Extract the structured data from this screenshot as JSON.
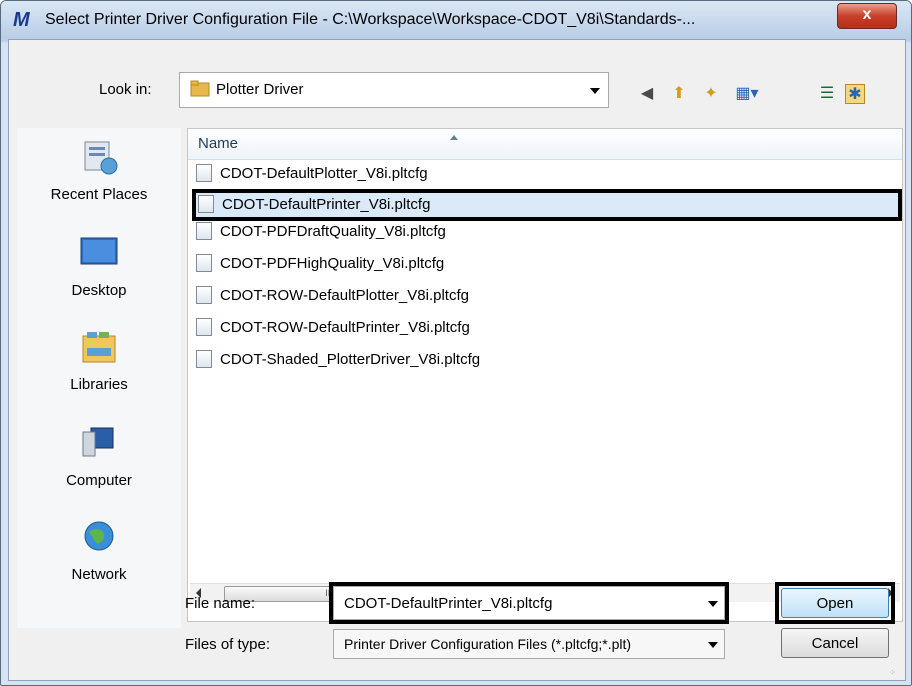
{
  "window": {
    "title": "Select Printer Driver Configuration File - C:\\Workspace\\Workspace-CDOT_V8i\\Standards-...",
    "close_label": "x"
  },
  "toolbar": {
    "look_in_label": "Look in:",
    "look_in_value": "Plotter Driver"
  },
  "places": [
    {
      "label": "Recent Places",
      "icon": "recent-places-icon"
    },
    {
      "label": "Desktop",
      "icon": "desktop-icon"
    },
    {
      "label": "Libraries",
      "icon": "libraries-icon"
    },
    {
      "label": "Computer",
      "icon": "computer-icon"
    },
    {
      "label": "Network",
      "icon": "network-icon"
    }
  ],
  "file_list": {
    "column_header": "Name",
    "items": [
      "CDOT-DefaultPlotter_V8i.pltcfg",
      "CDOT-DefaultPrinter_V8i.pltcfg",
      "CDOT-PDFDraftQuality_V8i.pltcfg",
      "CDOT-PDFHighQuality_V8i.pltcfg",
      "CDOT-ROW-DefaultPlotter_V8i.pltcfg",
      "CDOT-ROW-DefaultPrinter_V8i.pltcfg",
      "CDOT-Shaded_PlotterDriver_V8i.pltcfg"
    ],
    "selected_index": 1
  },
  "scrollbar": {
    "thumb_grip": "III"
  },
  "footer": {
    "file_name_label": "File name:",
    "file_name_value": "CDOT-DefaultPrinter_V8i.pltcfg",
    "file_type_label": "Files of type:",
    "file_type_value": "Printer Driver Configuration Files (*.pltcfg;*.plt)",
    "open_label": "Open",
    "cancel_label": "Cancel"
  },
  "colors": {
    "title_bar": "#c5d8ef",
    "close_button": "#c7402a",
    "selection": "#dbeaf8",
    "highlight_box": "#000000"
  }
}
